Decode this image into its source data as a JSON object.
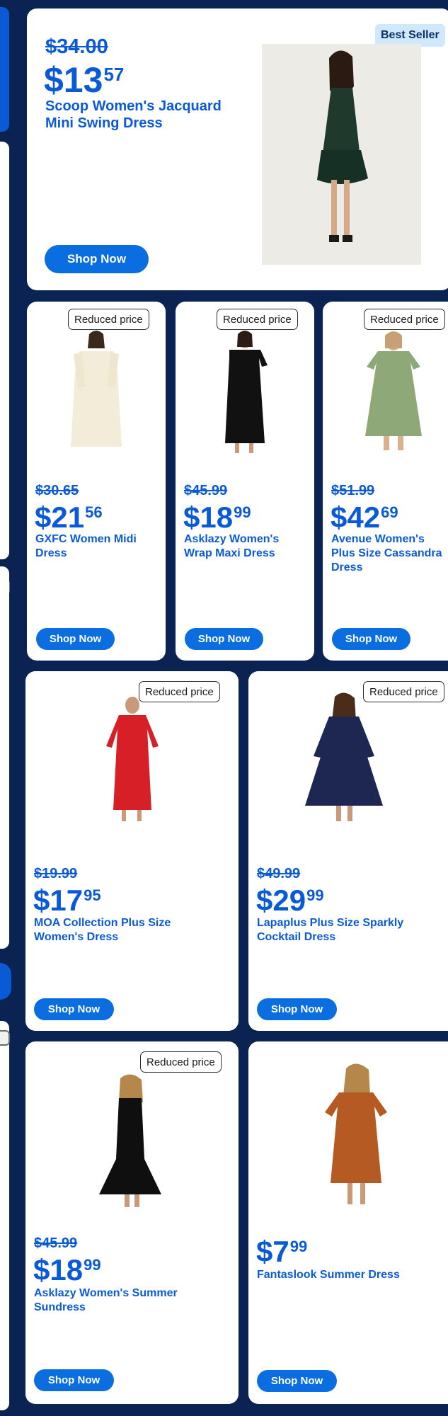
{
  "hero": {
    "badge": "Best Seller",
    "old_price": "$34.00",
    "price_dollars": "$13",
    "price_cents": "57",
    "title_line1": "Scoop Women's Jacquard",
    "title_line2": "Mini Swing Dress",
    "button": "Shop Now"
  },
  "row1": [
    {
      "badge": "Reduced price",
      "old_price": "$30.65",
      "price_dollars": "$21",
      "price_cents": "56",
      "title_line1": "GXFC Women Midi",
      "title_line2": "Dress",
      "title_line3": "",
      "button": "Shop Now"
    },
    {
      "badge": "Reduced price",
      "old_price": "$45.99",
      "price_dollars": "$18",
      "price_cents": "99",
      "title_line1": "Asklazy Women's",
      "title_line2": "Wrap Maxi Dress",
      "title_line3": "",
      "button": "Shop Now"
    },
    {
      "badge": "Reduced price",
      "old_price": "$51.99",
      "price_dollars": "$42",
      "price_cents": "69",
      "title_line1": "Avenue Women's",
      "title_line2": "Plus Size Cassandra",
      "title_line3": "Dress",
      "button": "Shop Now"
    }
  ],
  "row2": [
    {
      "badge": "Reduced price",
      "old_price": "$19.99",
      "price_dollars": "$17",
      "price_cents": "95",
      "title_line1": "MOA Collection Plus Size",
      "title_line2": "Women's Dress",
      "button": "Shop Now"
    },
    {
      "badge": "Reduced price",
      "old_price": "$49.99",
      "price_dollars": "$29",
      "price_cents": "99",
      "title_line1": "Lapaplus Plus Size Sparkly",
      "title_line2": "Cocktail Dress",
      "button": "Shop Now"
    }
  ],
  "row3": [
    {
      "badge": "Reduced price",
      "old_price": "$45.99",
      "price_dollars": "$18",
      "price_cents": "99",
      "title_line1": "Asklazy Women's Summer",
      "title_line2": "Sundress",
      "button": "Shop Now"
    },
    {
      "price_dollars": "$7",
      "price_cents": "99",
      "title_line1": "Fantaslook Summer Dress",
      "button": "Shop Now"
    }
  ],
  "colors": {
    "accent": "#0a5ad6",
    "button": "#0a6ee0",
    "background": "#0b2353",
    "badge_best": "#cfe8fb"
  }
}
